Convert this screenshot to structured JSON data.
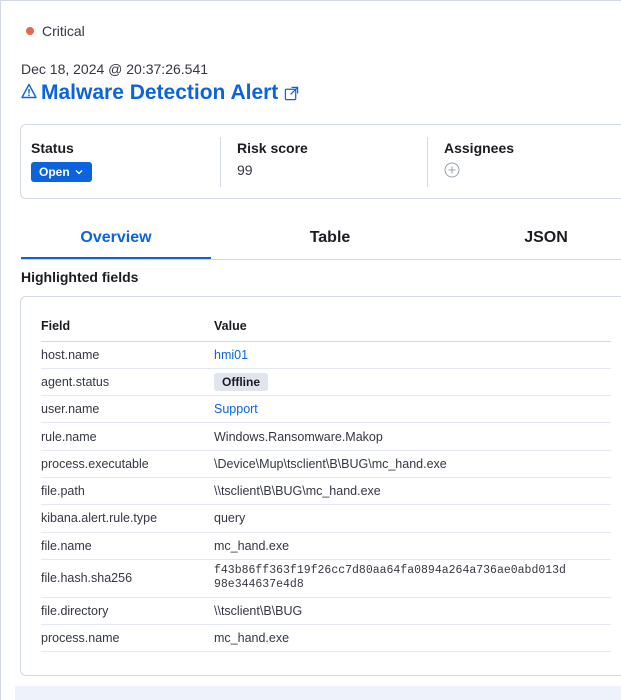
{
  "header": {
    "severity": "Critical",
    "severity_color": "#e7664c",
    "timestamp": "Dec 18, 2024 @ 20:37:26.541",
    "title": "Malware Detection Alert",
    "title_icon": "warning-icon",
    "title_link_icon": "external-link-icon"
  },
  "summary": {
    "status_label": "Status",
    "status_value": "Open",
    "risk_label": "Risk score",
    "risk_value": "99",
    "assignees_label": "Assignees",
    "assignees_icon": "add-circle-icon"
  },
  "tabs": [
    {
      "label": "Overview",
      "active": true
    },
    {
      "label": "Table",
      "active": false
    },
    {
      "label": "JSON",
      "active": false
    }
  ],
  "highlighted": {
    "title": "Highlighted fields",
    "col_field": "Field",
    "col_value": "Value",
    "rows": [
      {
        "field": "host.name",
        "value": "hmi01"
      },
      {
        "field": "agent.status",
        "value": "Offline"
      },
      {
        "field": "user.name",
        "value": "Support"
      },
      {
        "field": "rule.name",
        "value": "Windows.Ransomware.Makop"
      },
      {
        "field": "process.executable",
        "value": "\\Device\\Mup\\tsclient\\B\\BUG\\mc_hand.exe"
      },
      {
        "field": "file.path",
        "value": "\\\\tsclient\\B\\BUG\\mc_hand.exe"
      },
      {
        "field": "kibana.alert.rule.type",
        "value": "query"
      },
      {
        "field": "file.name",
        "value": "mc_hand.exe"
      },
      {
        "field": "file.hash.sha256",
        "value_line1": "f43b86ff363f19f26cc7d80aa64fa0894a264a736ae0abd013d",
        "value_line2": "98e344637e4d8"
      },
      {
        "field": "file.directory",
        "value": "\\\\tsclient\\B\\BUG"
      },
      {
        "field": "process.name",
        "value": "mc_hand.exe"
      }
    ]
  },
  "colors": {
    "accent": "#0b64dd",
    "border": "#d3dae6"
  }
}
